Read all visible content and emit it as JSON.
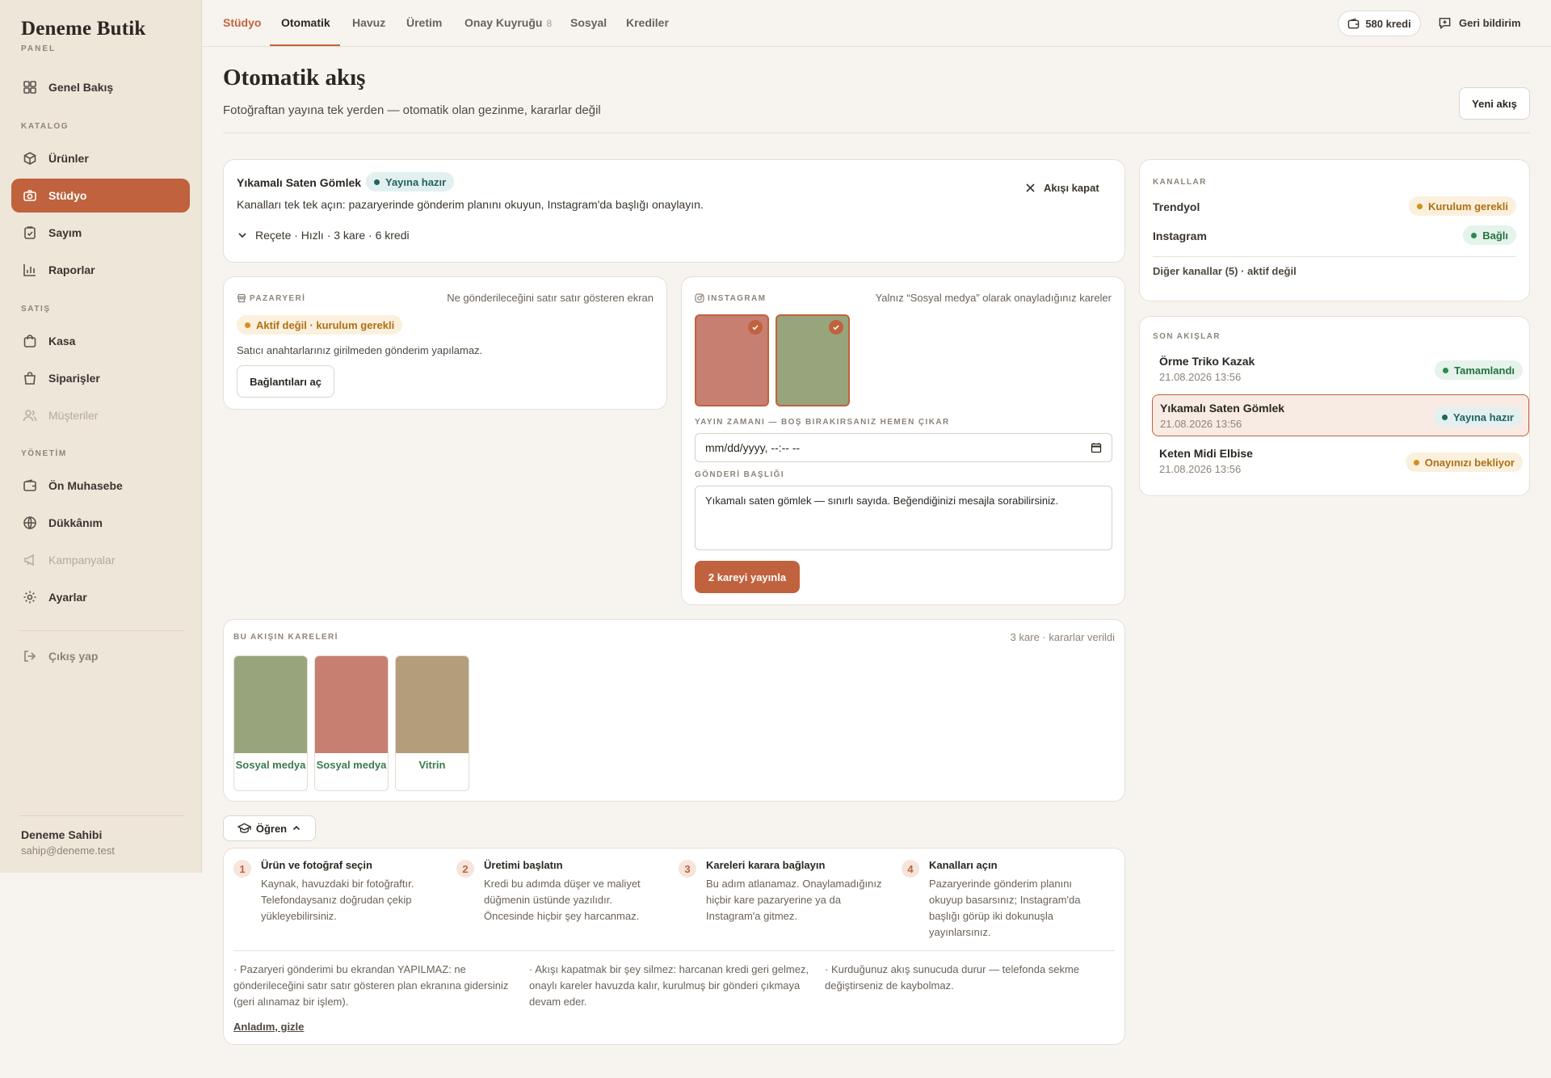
{
  "sidebar": {
    "brand": "Deneme Butik",
    "brand_sub": "PANEL",
    "overview": "Genel Bakış",
    "sections": {
      "catalog": "KATALOG",
      "sales": "SATIŞ",
      "management": "YÖNETİM"
    },
    "items": {
      "products": "Ürünler",
      "studio": "Stüdyo",
      "inventory": "Sayım",
      "reports": "Raporlar",
      "cashier": "Kasa",
      "orders": "Siparişler",
      "customers": "Müşteriler",
      "accounting": "Ön Muhasebe",
      "my_shop": "Dükkânım",
      "campaigns": "Kampanyalar",
      "settings": "Ayarlar"
    },
    "logout": "Çıkış yap",
    "user": {
      "name": "Deneme Sahibi",
      "email": "sahip@deneme.test"
    }
  },
  "topbar": {
    "tabs": {
      "studio": "Stüdyo",
      "auto": "Otomatik",
      "pool": "Havuz",
      "production": "Üretim",
      "approval": "Onay Kuyruğu",
      "approval_count": "8",
      "social": "Sosyal",
      "credits": "Krediler"
    },
    "credits": "580 kredi",
    "feedback": "Geri bildirim"
  },
  "page": {
    "title": "Otomatik akış",
    "subtitle": "Fotoğraftan yayına tek yerden — otomatik olan gezinme, kararlar değil",
    "new_flow": "Yeni akış"
  },
  "flow": {
    "title": "Yıkamalı Saten Gömlek",
    "status": "Yayına hazır",
    "desc": "Kanalları tek tek açın: pazaryerinde gönderim planını okuyun, Instagram'da başlığı onaylayın.",
    "recipe": "Reçete · Hızlı · 3 kare · 6 kredi",
    "close": "Akışı kapat"
  },
  "channels": {
    "label": "KANALLAR",
    "rows": [
      {
        "name": "Trendyol",
        "status": "Kurulum gerekli"
      },
      {
        "name": "Instagram",
        "status": "Bağlı"
      }
    ],
    "other": "Diğer kanallar (5) · aktif değil"
  },
  "recent": {
    "label": "SON AKIŞLAR",
    "items": [
      {
        "name": "Örme Triko Kazak",
        "date": "21.08.2026 13:56",
        "status": "Tamamlandı"
      },
      {
        "name": "Yıkamalı Saten Gömlek",
        "date": "21.08.2026 13:56",
        "status": "Yayına hazır"
      },
      {
        "name": "Keten Midi Elbise",
        "date": "21.08.2026 13:56",
        "status": "Onayınızı bekliyor"
      }
    ]
  },
  "marketplace": {
    "label": "PAZARYERİ",
    "hint": "Ne gönderileceğini satır satır gösteren ekran",
    "status": "Aktif değil · kurulum gerekli",
    "desc": "Satıcı anahtarlarınız girilmeden gönderim yapılamaz.",
    "button": "Bağlantıları aç"
  },
  "instagram": {
    "label": "INSTAGRAM",
    "hint": "Yalnız “Sosyal medya” olarak onayladığınız kareler",
    "frames": [
      {
        "color": "#c77f72"
      },
      {
        "color": "#98a57c"
      }
    ],
    "schedule_label": "YAYIN ZAMANI — BOŞ BIRAKIRSANIZ HEMEN ÇIKAR",
    "schedule_value": "mm/dd/yyyy, --:-- --",
    "caption_label": "GÖNDERİ BAŞLIĞI",
    "caption": "Yıkamalı saten gömlek — sınırlı sayıda. Beğendiğinizi mesajla sorabilirsiniz.",
    "publish": "2 kareyi yayınla"
  },
  "frames": {
    "label": "BU AKIŞIN KARELERİ",
    "meta": "3 kare · kararlar verildi",
    "items": [
      {
        "color": "#98a57c",
        "tag": "Sosyal medya"
      },
      {
        "color": "#c77f72",
        "tag": "Sosyal medya"
      },
      {
        "color": "#b39d7a",
        "tag": "Vitrin"
      }
    ]
  },
  "learn": {
    "button": "Öğren",
    "steps": [
      {
        "num": "1",
        "title": "Ürün ve fotoğraf seçin",
        "desc": "Kaynak, havuzdaki bir fotoğraftır. Telefondaysanız doğrudan çekip yükleyebilirsiniz."
      },
      {
        "num": "2",
        "title": "Üretimi başlatın",
        "desc": "Kredi bu adımda düşer ve maliyet düğmenin üstünde yazılıdır. Öncesinde hiçbir şey harcanmaz."
      },
      {
        "num": "3",
        "title": "Kareleri karara bağlayın",
        "desc": "Bu adım atlanamaz. Onaylamadığınız hiçbir kare pazaryerine ya da Instagram'a gitmez."
      },
      {
        "num": "4",
        "title": "Kanalları açın",
        "desc": "Pazaryerinde gönderim planını okuyup basarsınız; Instagram'da başlığı görüp iki dokunuşla yayınlarsınız."
      }
    ],
    "notes": [
      "· Pazaryeri gönderimi bu ekrandan YAPILMAZ: ne gönderileceğini satır satır gösteren plan ekranına gidersiniz (geri alınamaz bir işlem).",
      "· Akışı kapatmak bir şey silmez: harcanan kredi geri gelmez, onaylı kareler havuzda kalır, kurulmuş bir gönderi çıkmaya devam eder.",
      "· Kurduğunuz akış sunucuda durur — telefonda sekme değiştirseniz de kaybolmaz."
    ],
    "dismiss": "Anladım, gizle"
  }
}
